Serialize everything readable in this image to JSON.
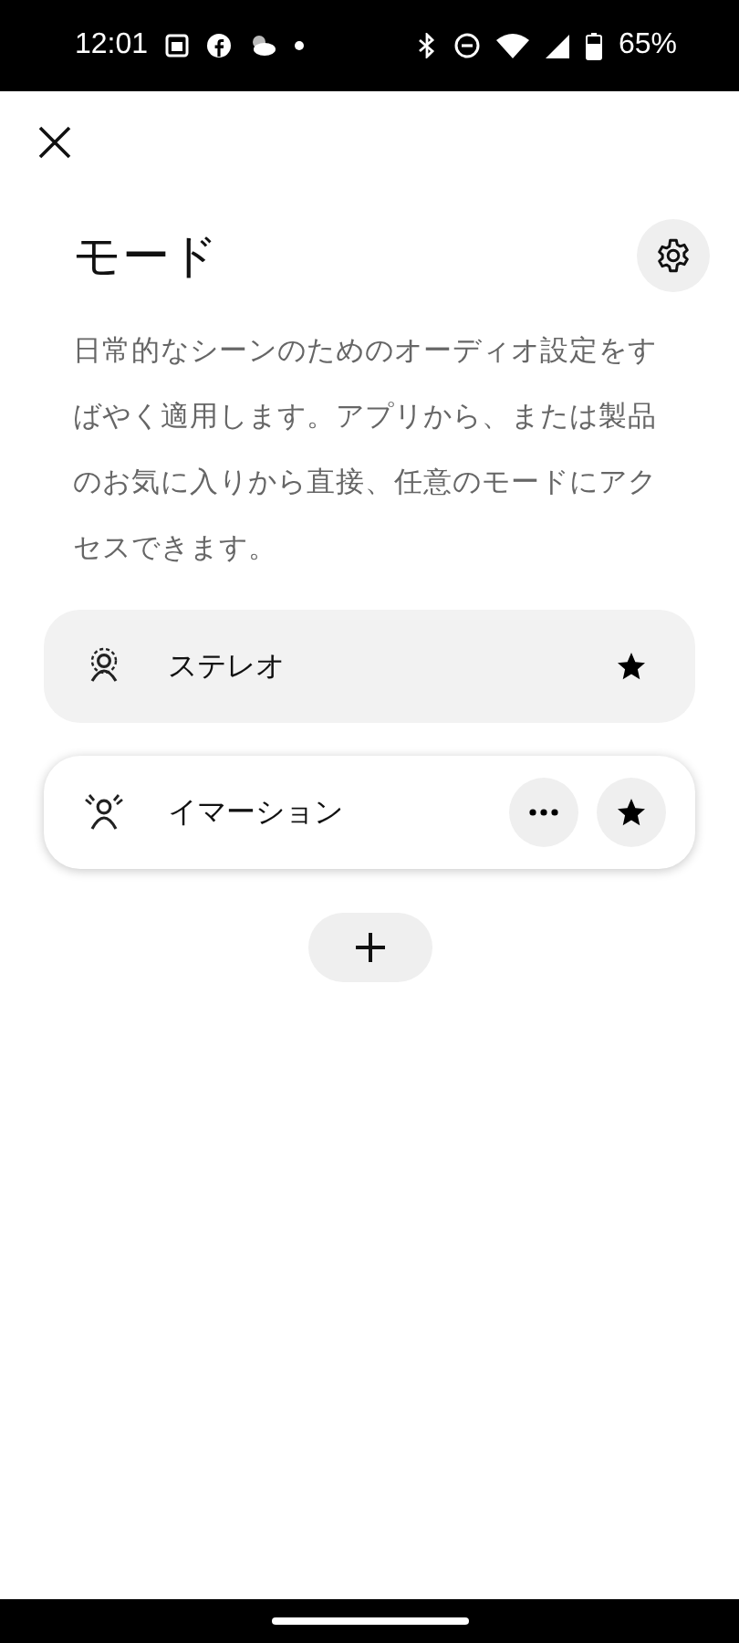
{
  "status_bar": {
    "time": "12:01",
    "battery": "65%"
  },
  "title": "モード",
  "description": "日常的なシーンのためのオーディオ設定をすばやく適用します。アプリから、または製品のお気に入りから直接、任意のモードにアクセスできます。",
  "modes": [
    {
      "label": "ステレオ",
      "kind": "stereo",
      "selected": false
    },
    {
      "label": "イマーション",
      "kind": "immersion",
      "selected": true
    }
  ]
}
